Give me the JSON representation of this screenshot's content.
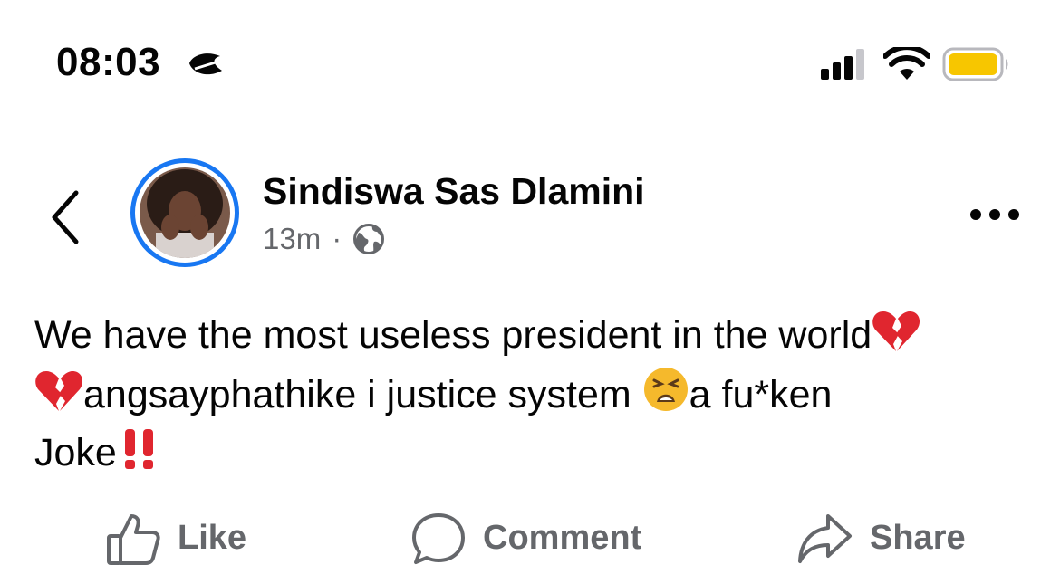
{
  "status_bar": {
    "time": "08:03",
    "focus_icon": "sleep-focus-icon",
    "signal_icon": "cellular-signal-icon",
    "wifi_icon": "wifi-icon",
    "battery_icon": "battery-low-power-icon",
    "battery_color": "#f7c600"
  },
  "header": {
    "author_name": "Sindiswa Sas Dlamini",
    "post_time": "13m",
    "separator": "·",
    "audience_icon": "globe-icon",
    "ring_color": "#1877f2"
  },
  "post": {
    "line1": "We have the most useless president in the world",
    "line2_a": "angsayphathike i justice system ",
    "line2_b": "a fu*ken",
    "line3": "Joke",
    "emojis": [
      "broken-heart",
      "broken-heart",
      "weary-face",
      "double-exclamation"
    ]
  },
  "actions": {
    "like_label": "Like",
    "comment_label": "Comment",
    "share_label": "Share"
  },
  "colors": {
    "secondary_text": "#65676b",
    "primary_text": "#050505"
  }
}
